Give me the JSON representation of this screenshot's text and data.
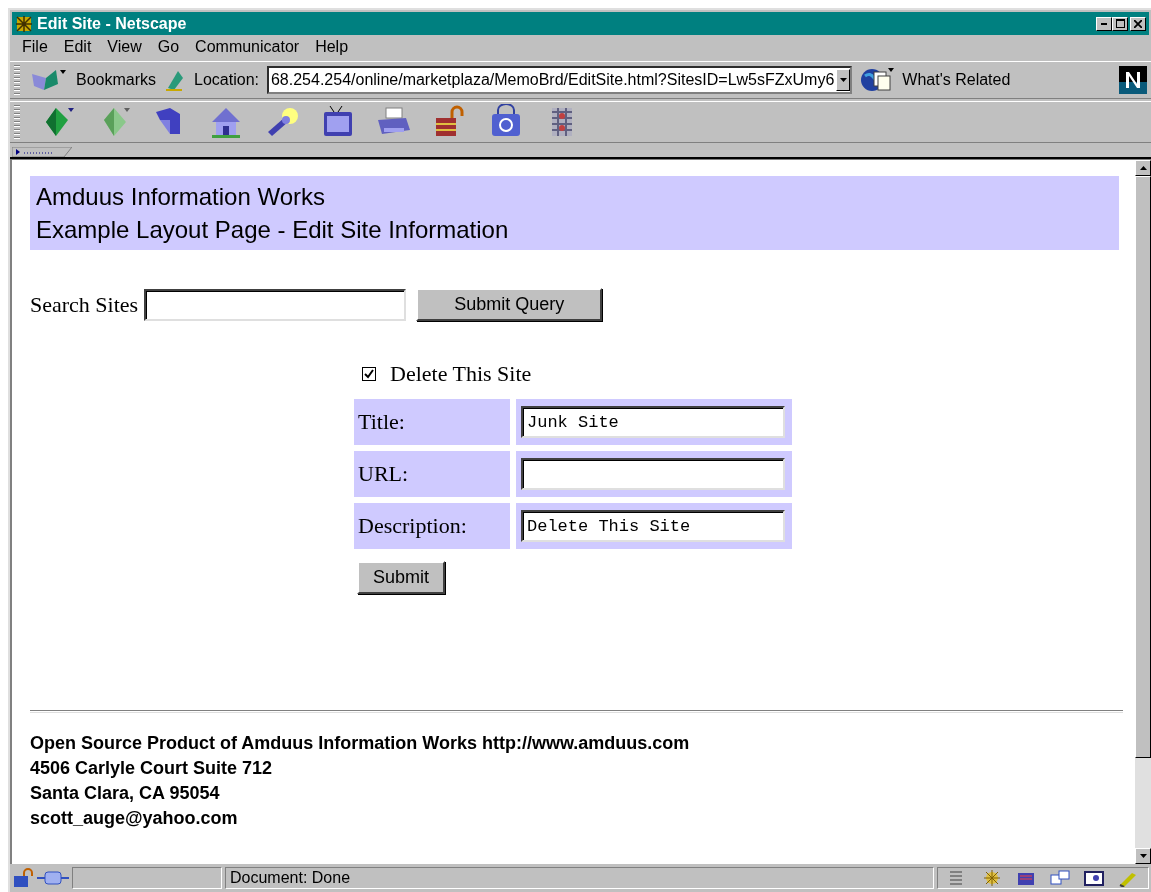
{
  "window": {
    "title": "Edit Site - Netscape"
  },
  "menu": [
    "File",
    "Edit",
    "View",
    "Go",
    "Communicator",
    "Help"
  ],
  "location_bar": {
    "bookmarks": "Bookmarks",
    "location_label": "Location:",
    "url": "68.254.254/online/marketplaza/MemoBrd/EditSite.html?SitesID=Lw5sFZxUmy6",
    "whats_related": "What's Related"
  },
  "page": {
    "header": [
      "Amduus Information Works",
      "Example Layout Page - Edit Site Information"
    ],
    "search": {
      "label": "Search Sites",
      "button": "Submit Query"
    },
    "delete": {
      "label": "Delete This Site",
      "checked": true
    },
    "fields": [
      {
        "label": "Title:",
        "value": "Junk Site"
      },
      {
        "label": "URL:"
      },
      {
        "label": "Description:",
        "value": "Delete This Site"
      }
    ],
    "submit": "Submit",
    "footer": [
      "Open Source Product of Amduus Information Works http://www.amduus.com",
      "4506 Carlyle Court Suite 712",
      "Santa Clara, CA 95054",
      "scott_auge@yahoo.com"
    ]
  },
  "status_bar": {
    "text": "Document: Done"
  }
}
